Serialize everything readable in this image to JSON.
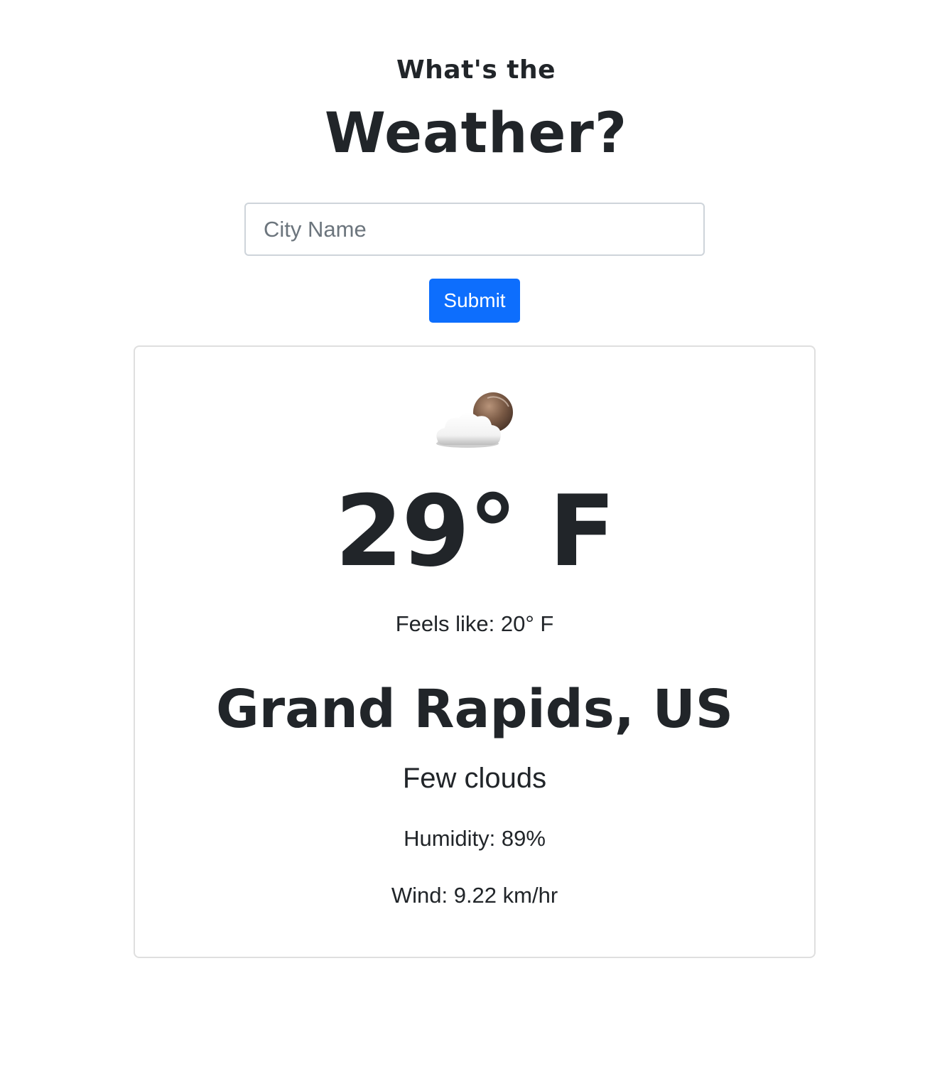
{
  "header": {
    "subtitle": "What's the",
    "title": "Weather?"
  },
  "search": {
    "placeholder": "City Name",
    "value": "",
    "submit_label": "Submit"
  },
  "weather": {
    "icon": "few-clouds-night-icon",
    "temperature": "29° F",
    "feels_like": "Feels like: 20° F",
    "location": "Grand Rapids, US",
    "description": "Few clouds",
    "humidity": "Humidity: 89%",
    "wind": "Wind: 9.22 km/hr"
  },
  "colors": {
    "primary": "#0d6efd",
    "text": "#212529",
    "placeholder": "#6c757d",
    "border": "#ced4da",
    "card_border": "#dfdfdf"
  }
}
